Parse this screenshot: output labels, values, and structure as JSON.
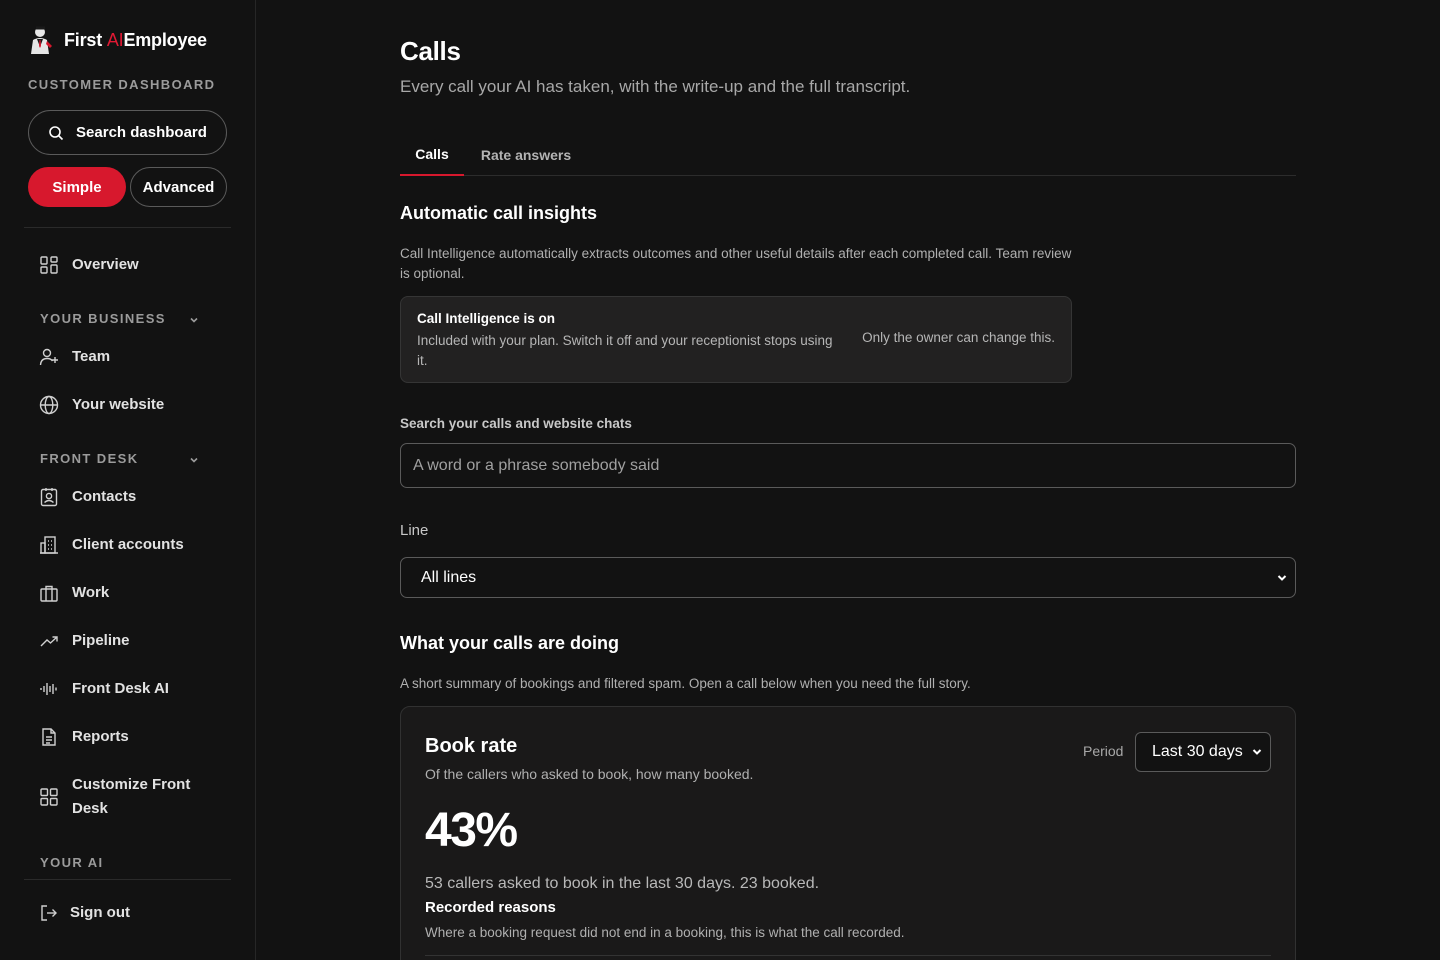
{
  "brand": {
    "first": "First",
    "ai": "AI",
    "rest": "Employee"
  },
  "sidebar": {
    "dashboard_label": "CUSTOMER DASHBOARD",
    "search_label": "Search dashboard",
    "mode_simple": "Simple",
    "mode_advanced": "Advanced",
    "overview": "Overview",
    "section_business": "YOUR BUSINESS",
    "team": "Team",
    "website": "Your website",
    "section_front_desk": "FRONT DESK",
    "contacts": "Contacts",
    "client_accounts": "Client accounts",
    "work": "Work",
    "pipeline": "Pipeline",
    "front_desk_ai": "Front Desk AI",
    "reports": "Reports",
    "customize": "Customize Front Desk",
    "section_ai": "YOUR AI",
    "sign_out": "Sign out"
  },
  "main": {
    "title": "Calls",
    "subtitle": "Every call your AI has taken, with the write-up and the full transcript.",
    "tabs": [
      {
        "label": "Calls",
        "active": true
      },
      {
        "label": "Rate answers",
        "active": false
      }
    ],
    "insights": {
      "heading": "Automatic call insights",
      "description": "Call Intelligence automatically extracts outcomes and other useful details after each completed call. Team review is optional.",
      "card_title": "Call Intelligence is on",
      "card_desc": "Included with your plan. Switch it off and your receptionist stops using it.",
      "card_note": "Only the owner can change this."
    },
    "search": {
      "label": "Search your calls and website chats",
      "placeholder": "A word or a phrase somebody said",
      "value": ""
    },
    "line": {
      "label": "Line",
      "selected": "All lines"
    },
    "calls_doing": {
      "heading": "What your calls are doing",
      "description": "A short summary of bookings and filtered spam. Open a call below when you need the full story."
    },
    "book_rate": {
      "title": "Book rate",
      "subtitle": "Of the callers who asked to book, how many booked.",
      "period_label": "Period",
      "period_selected": "Last 30 days",
      "value": "43%",
      "stats": "53 callers asked to book in the last 30 days. 23 booked.",
      "reasons_heading": "Recorded reasons",
      "reasons_desc": "Where a booking request did not end in a booking, this is what the call recorded."
    }
  },
  "colors": {
    "accent": "#d7182d",
    "background": "#121212"
  }
}
